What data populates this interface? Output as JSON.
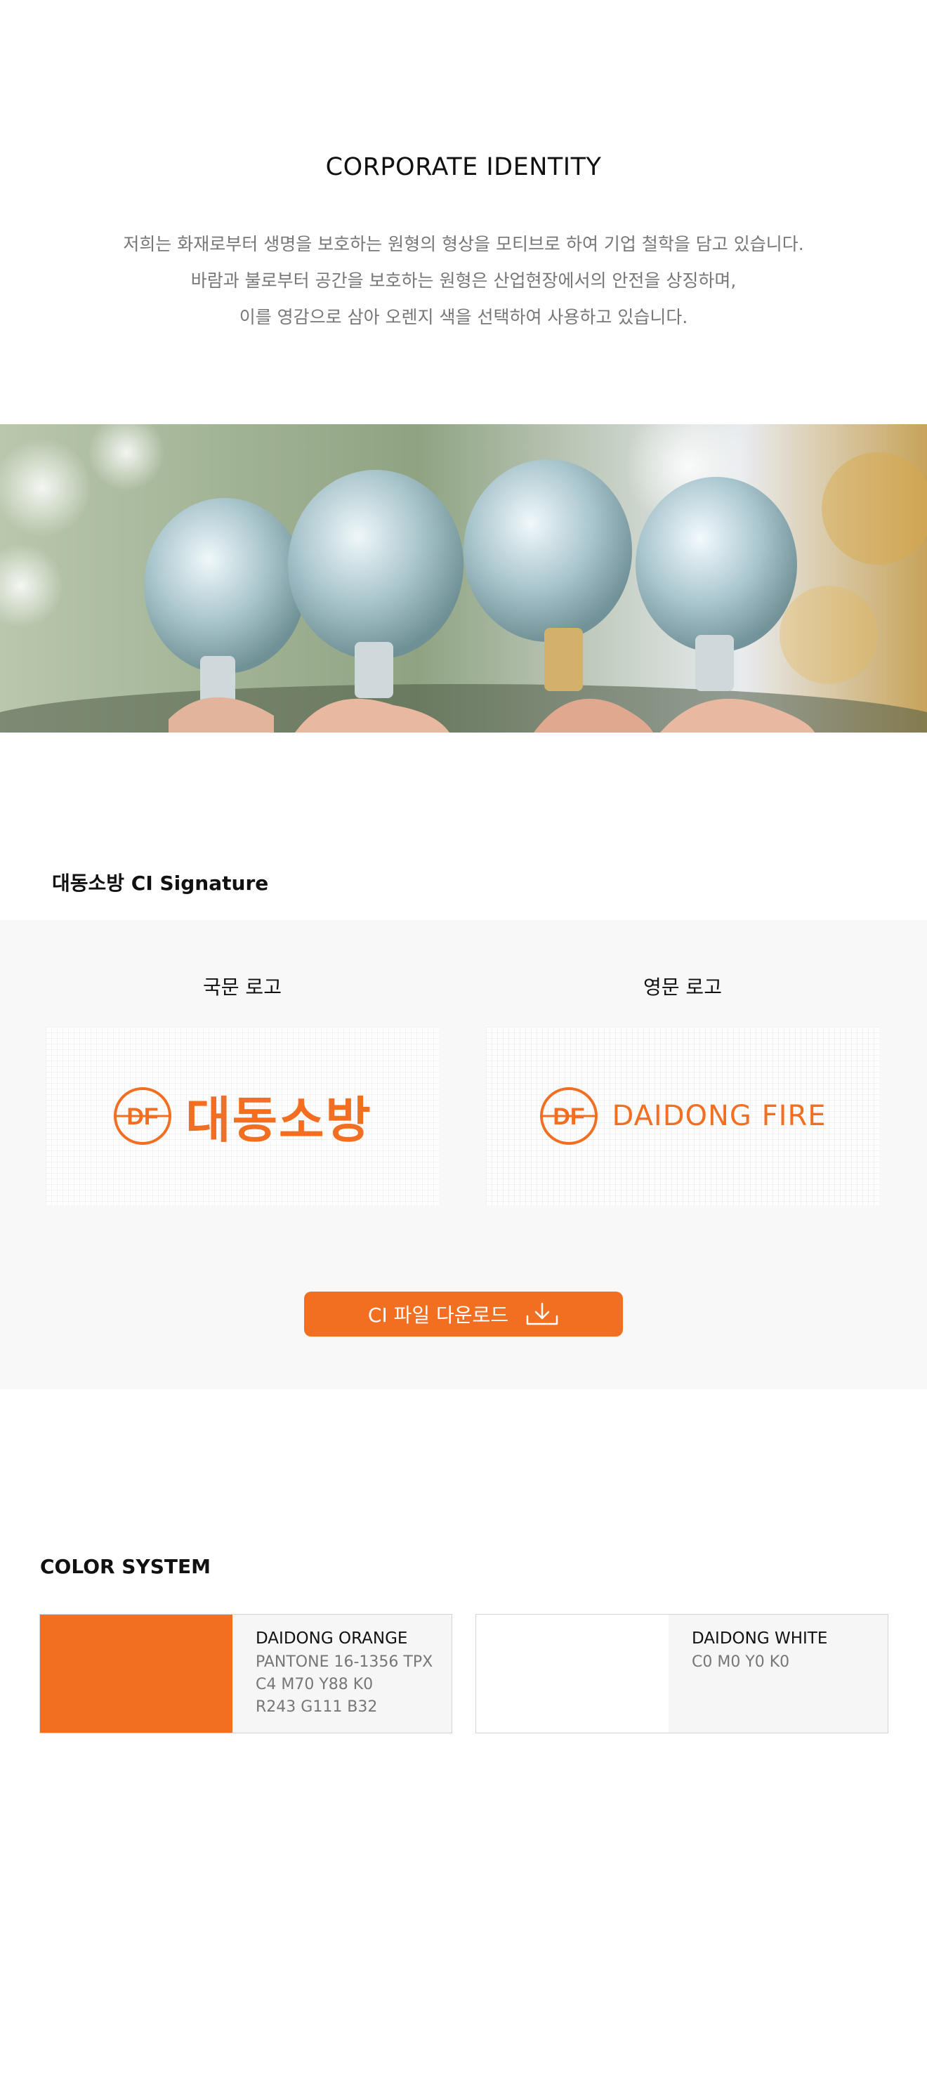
{
  "intro": {
    "title": "CORPORATE IDENTITY",
    "lines": [
      "저희는 화재로부터 생명을 보호하는 원형의 형상을 모티브로 하여 기업 철학을 담고 있습니다.",
      "바람과 불로부터 공간을 보호하는 원형은 산업현장에서의 안전을 상징하며,",
      "이를 영감으로 삼아 오렌지 색을 선택하여 사용하고 있습니다."
    ]
  },
  "signature": {
    "title": "대동소방 CI Signature",
    "korean_logo": {
      "label": "국문 로고",
      "mark": "DF",
      "name": "대동소방"
    },
    "english_logo": {
      "label": "영문 로고",
      "mark": "DF",
      "name": "DAIDONG FIRE"
    },
    "download_label": "CI 파일 다운로드",
    "download_icon": "download-icon"
  },
  "color_system": {
    "title": "COLOR SYSTEM",
    "swatches": [
      {
        "name": "DAIDONG ORANGE",
        "color": "#f26f22",
        "specs": [
          "PANTONE 16-1356 TPX",
          "C4 M70 Y88 K0",
          "R243 G111 B32"
        ]
      },
      {
        "name": "DAIDONG WHITE",
        "color": "#ffffff",
        "specs": [
          "C0 M0 Y0 K0"
        ]
      }
    ]
  },
  "colors": {
    "accent": "#f26f22",
    "panel": "#f8f8f8",
    "muted_text": "#777777"
  }
}
